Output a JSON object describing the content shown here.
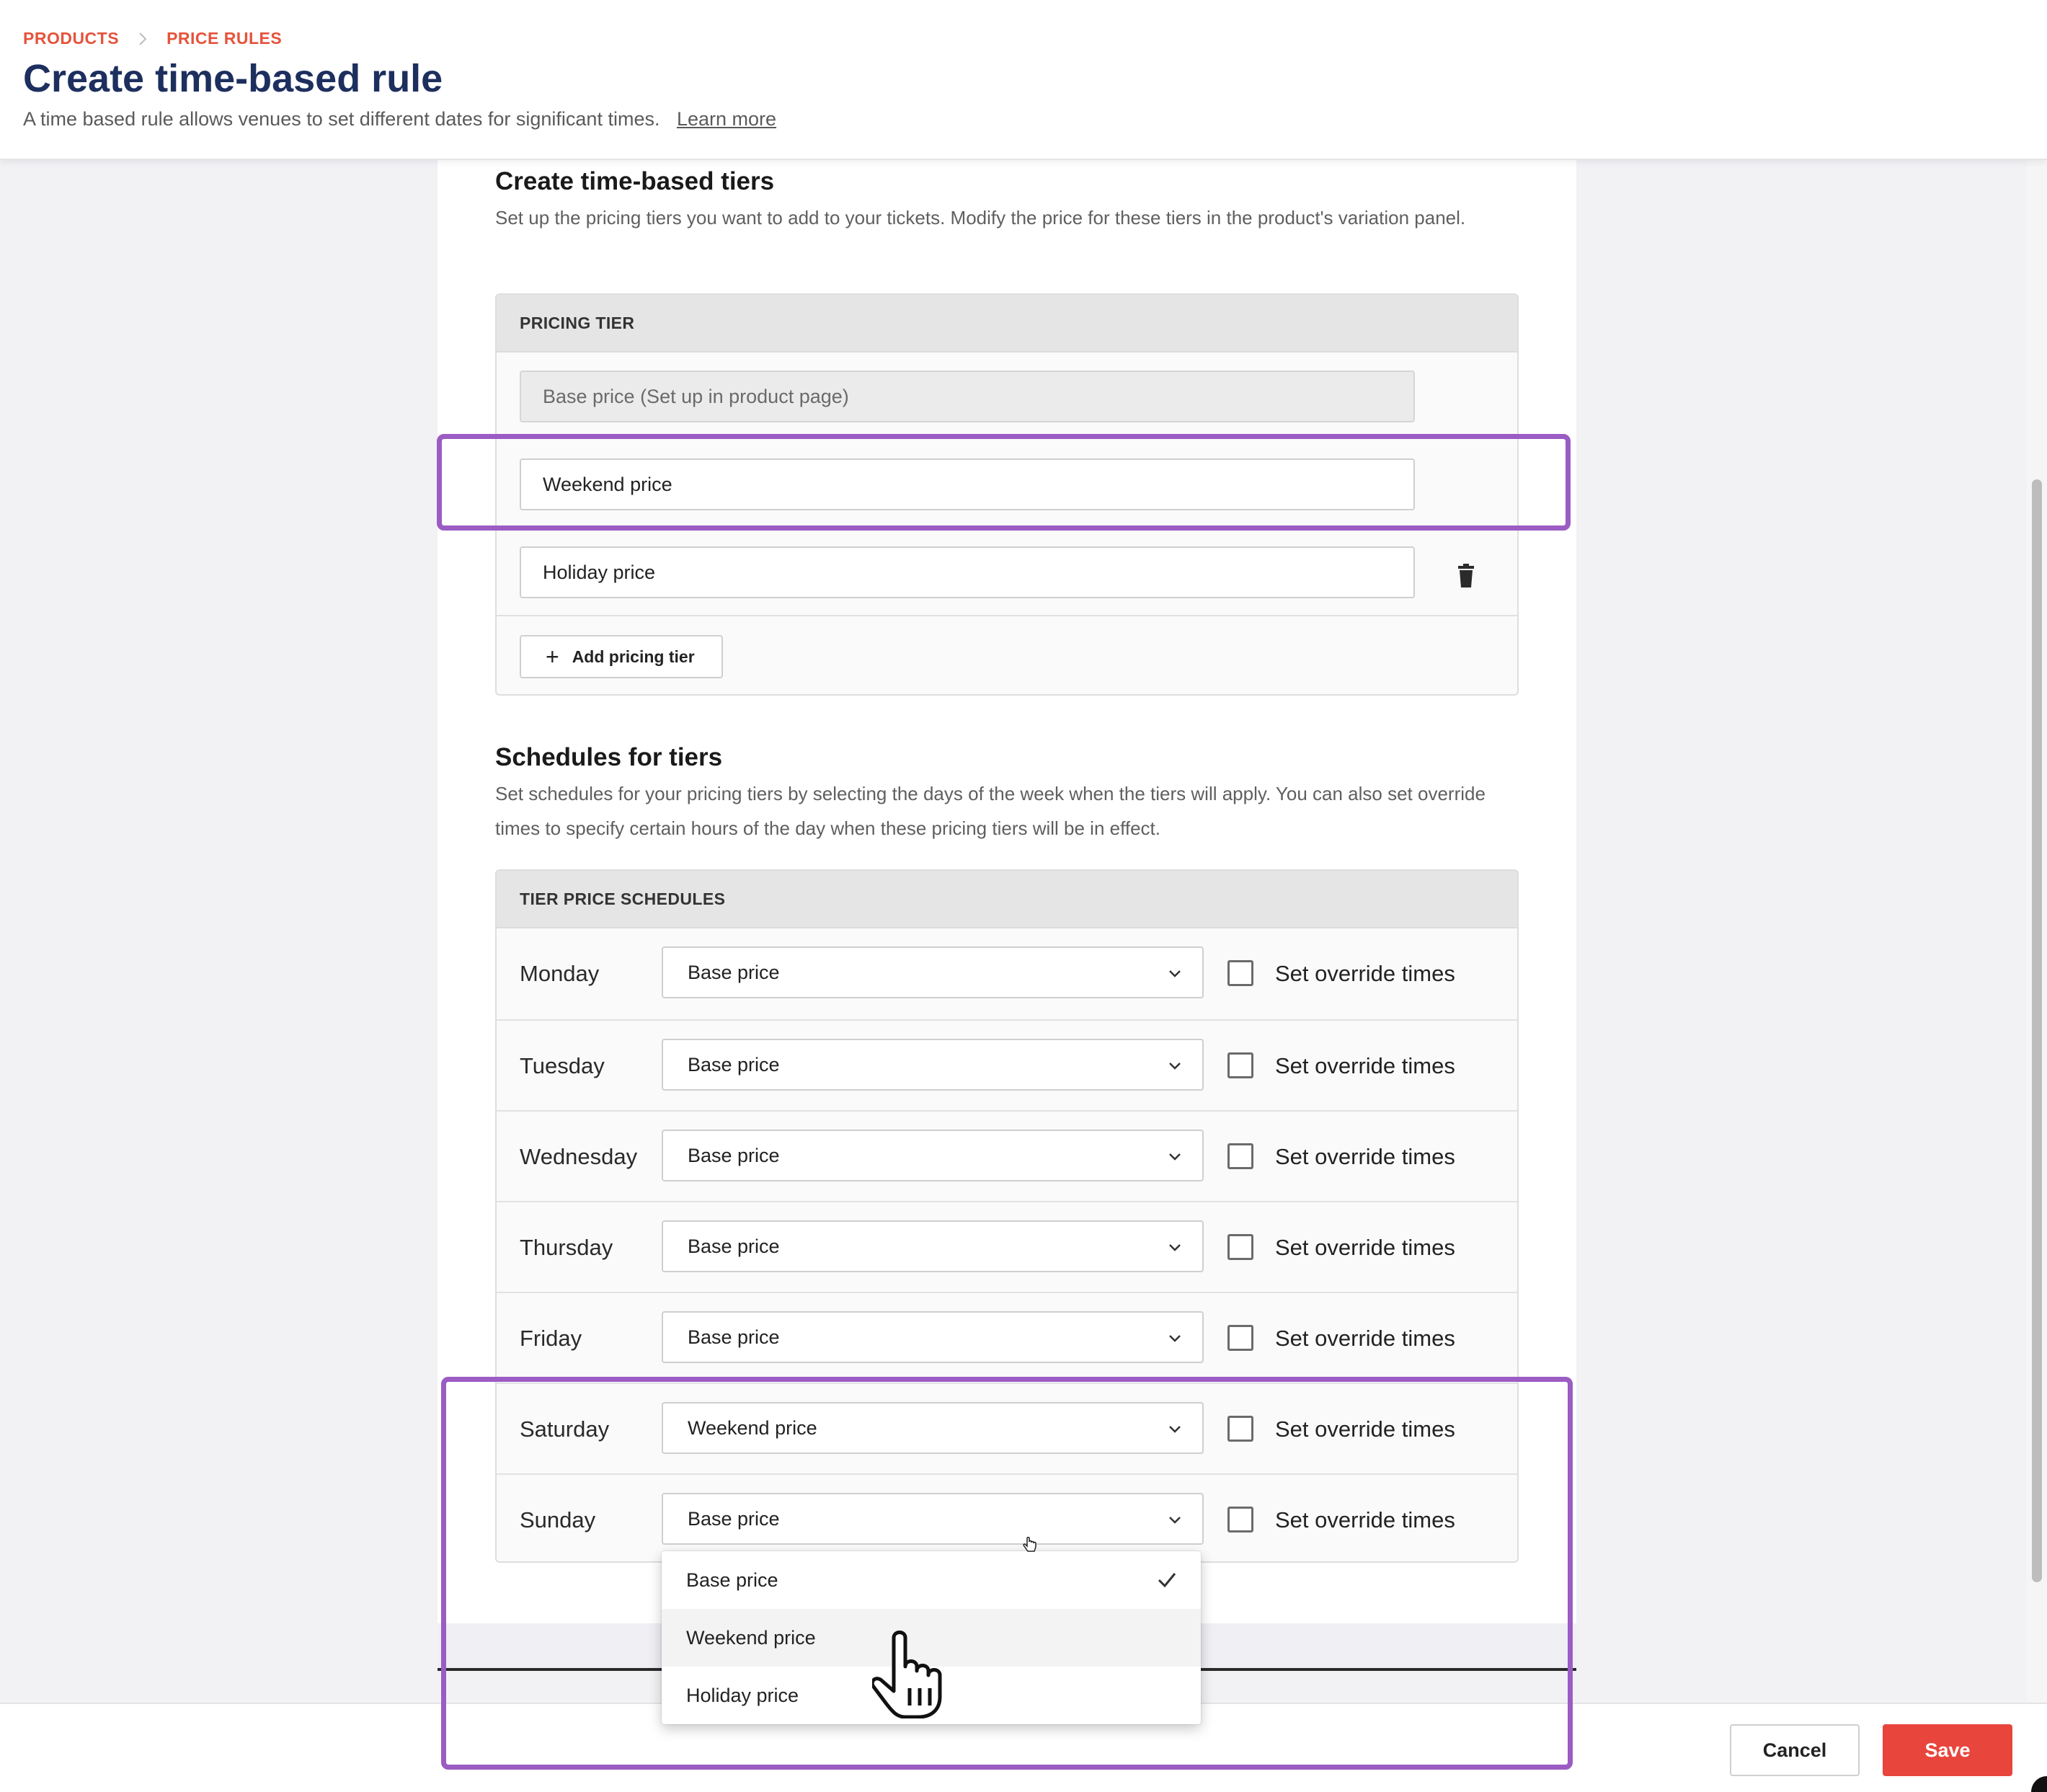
{
  "breadcrumb": {
    "items": [
      "PRODUCTS",
      "PRICE RULES"
    ]
  },
  "header": {
    "title": "Create time-based rule",
    "subtitle": "A time based rule allows venues to set different dates for significant times.",
    "learn_more": "Learn more"
  },
  "tiers_section": {
    "title": "Create time-based tiers",
    "description": "Set up the pricing tiers you want to add to your tickets. Modify the price for these tiers in the product's variation panel.",
    "box_header": "PRICING TIER",
    "base_tier_placeholder": "Base price (Set up in product page)",
    "tiers": [
      "Weekend price",
      "Holiday price"
    ],
    "add_button": "Add pricing tier"
  },
  "schedule_section": {
    "title": "Schedules for tiers",
    "description": "Set schedules for your pricing tiers by selecting the days of the week when the tiers will apply. You can also set override times to specify certain hours of the day when these pricing tiers will be in effect.",
    "box_header": "TIER PRICE SCHEDULES",
    "override_label": "Set override times",
    "rows": [
      {
        "day": "Monday",
        "tier": "Base price"
      },
      {
        "day": "Tuesday",
        "tier": "Base price"
      },
      {
        "day": "Wednesday",
        "tier": "Base price"
      },
      {
        "day": "Thursday",
        "tier": "Base price"
      },
      {
        "day": "Friday",
        "tier": "Base price"
      },
      {
        "day": "Saturday",
        "tier": "Weekend price"
      },
      {
        "day": "Sunday",
        "tier": "Base price"
      }
    ]
  },
  "dropdown": {
    "options": [
      "Base price",
      "Weekend price",
      "Holiday price"
    ],
    "selected": "Base price",
    "hovered": "Weekend price"
  },
  "footer": {
    "cancel_label": "Cancel",
    "save_label": "Save"
  },
  "colors": {
    "brand_title": "#1d2f5e",
    "breadcrumb": "#e5533c",
    "save": "#e8453c",
    "highlight": "#9b5cc3"
  }
}
